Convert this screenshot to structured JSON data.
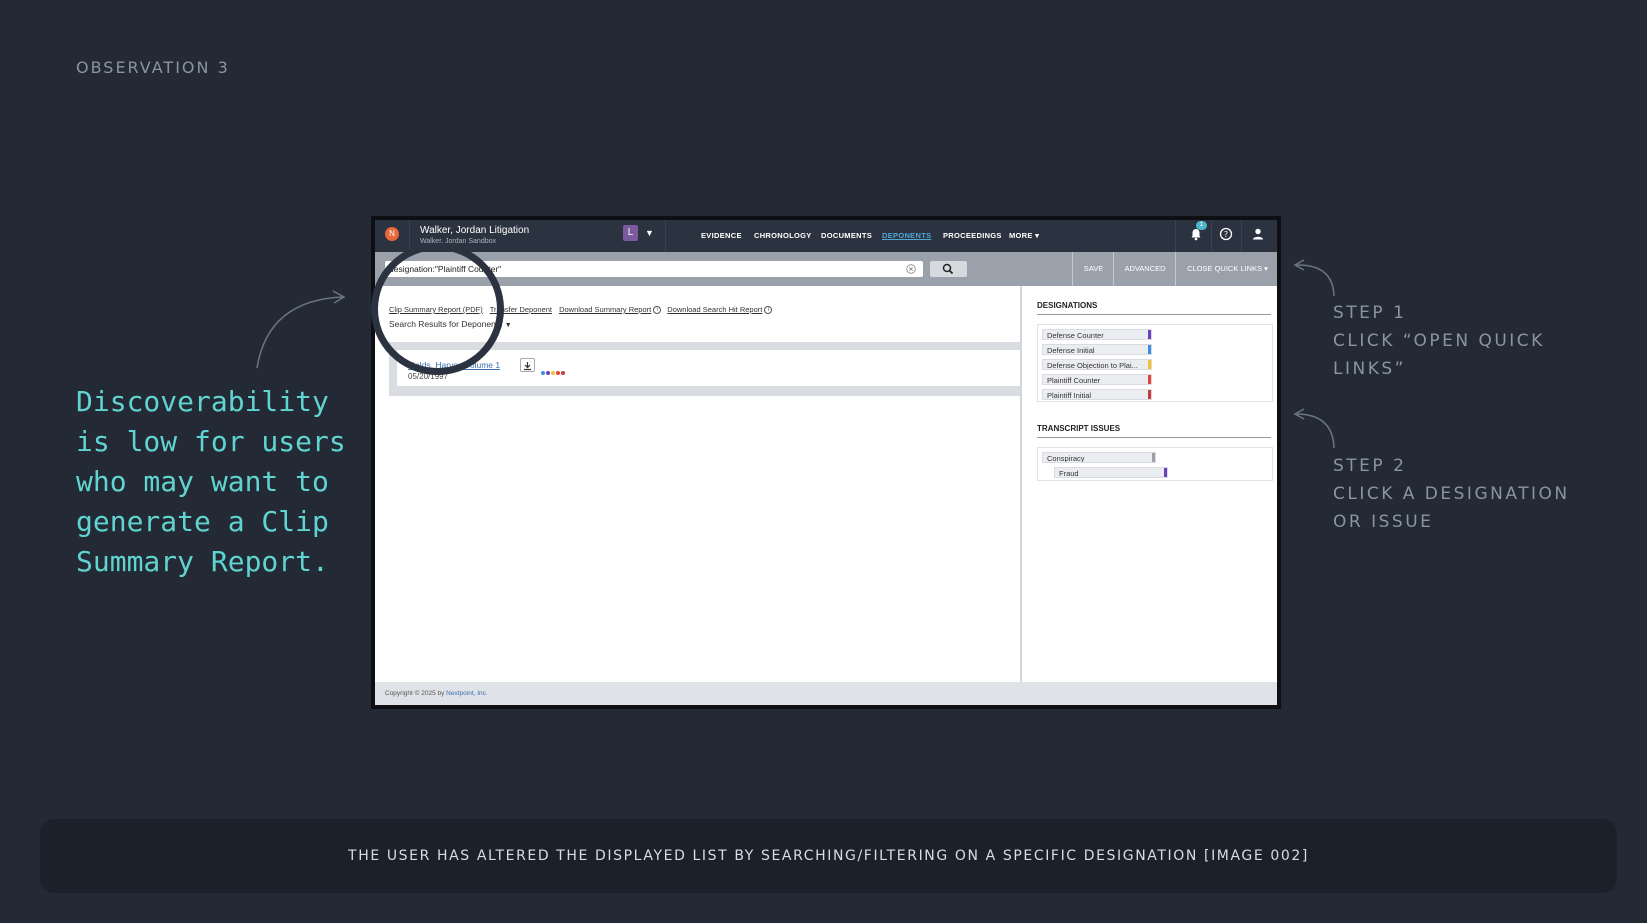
{
  "slide": {
    "observation_label": "OBSERVATION 3",
    "left_note": "Discoverability is low for users who may want to generate a Clip Summary Report.",
    "step1_title": "STEP 1",
    "step1_text": "CLICK “OPEN QUICK LINKS”",
    "step2_title": "STEP 2",
    "step2_text": "CLICK A DESIGNATION OR ISSUE",
    "caption": "THE USER HAS ALTERED THE DISPLAYED LIST BY SEARCHING/FILTERING ON A SPECIFIC DESIGNATION [IMAGE 002]"
  },
  "app": {
    "case_title": "Walker, Jordan Litigation",
    "case_subtitle": "Walker, Jordan Sandbox",
    "user_badge": "L",
    "nav": [
      "EVIDENCE",
      "CHRONOLOGY",
      "DOCUMENTS",
      "DEPONENTS",
      "PROCEEDINGS",
      "MORE ▾"
    ],
    "active_nav": "DEPONENTS",
    "notification_count": "1",
    "search_value": "designation:\"Plaintiff Counter\"",
    "toolbar": {
      "save": "SAVE",
      "advanced": "ADVANCED",
      "close_quick_links": "CLOSE QUICK LINKS ▾"
    },
    "links": [
      "Clip Summary Report (PDF)",
      "Transfer Deponent",
      "Download Summary Report",
      "Download Search Hit Report"
    ],
    "results_label": "Search Results for Deponents",
    "result": {
      "name": "Fields, Harvey Volume 1",
      "date": "05/20/1997"
    },
    "designations_title": "DESIGNATIONS",
    "designations": [
      {
        "label": "Defense Counter",
        "color": "#6a3fc1"
      },
      {
        "label": "Defense Initial",
        "color": "#3d8fe0"
      },
      {
        "label": "Defense Objection to Plai...",
        "color": "#f2c230"
      },
      {
        "label": "Plaintiff Counter",
        "color": "#e0443a"
      },
      {
        "label": "Plaintiff Initial",
        "color": "#c83a3a"
      }
    ],
    "issues_title": "TRANSCRIPT ISSUES",
    "issues": [
      {
        "label": "Conspiracy",
        "color": "#9aa0a8"
      },
      {
        "label": "Fraud",
        "color": "#6a3fc1"
      }
    ],
    "footer_text": "Copyright © 2025 by ",
    "footer_link": "Nextpoint, Inc."
  }
}
